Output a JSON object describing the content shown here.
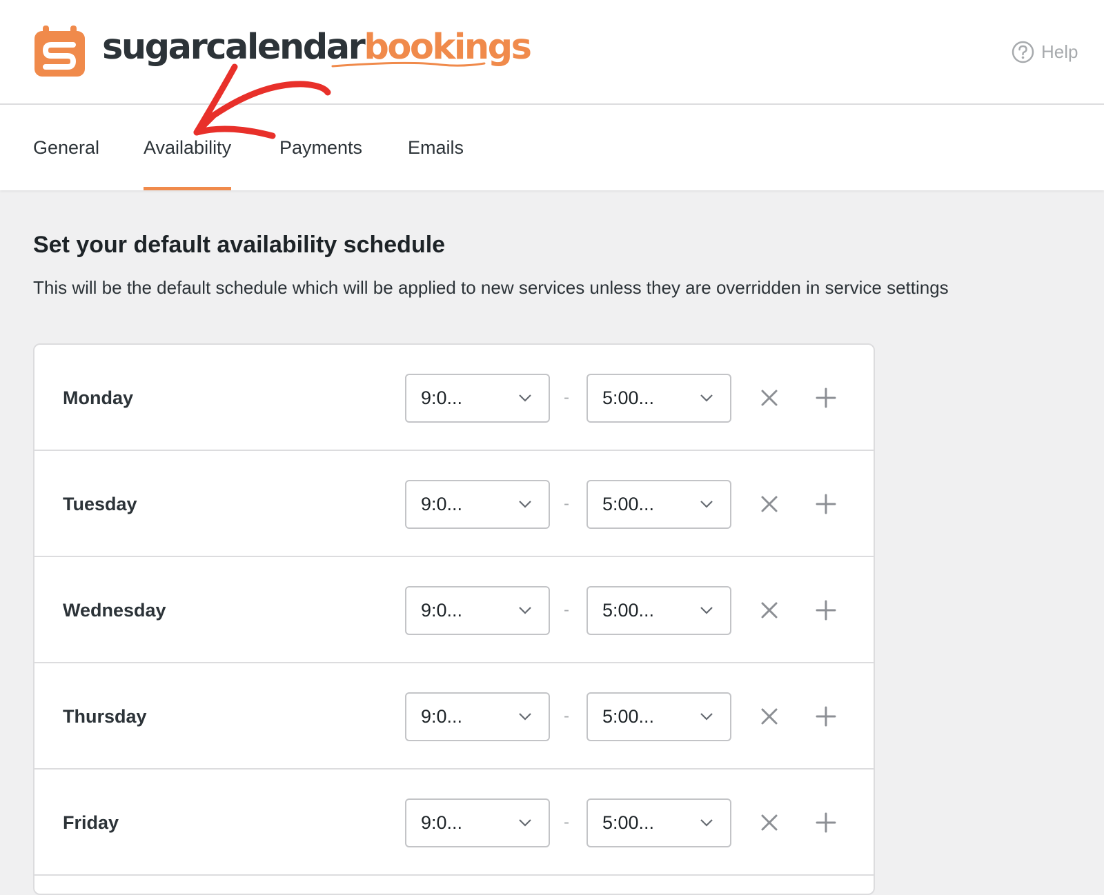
{
  "brand": {
    "name_dark": "sugarcalendar",
    "name_accent": "bookings",
    "accent_color": "#f08a4b",
    "logo_icon": "calendar-s-logo-icon"
  },
  "header": {
    "help_label": "Help",
    "help_icon": "question-circle-icon"
  },
  "tabs": [
    {
      "label": "General",
      "active": false
    },
    {
      "label": "Availability",
      "active": true
    },
    {
      "label": "Payments",
      "active": false
    },
    {
      "label": "Emails",
      "active": false
    }
  ],
  "main": {
    "title": "Set your default availability schedule",
    "description": "This will be the default schedule which will be applied to new services unless they are overridden in service settings"
  },
  "schedule": {
    "separator": "-",
    "days": [
      {
        "day": "Monday",
        "start": "9:0...",
        "end": "5:00..."
      },
      {
        "day": "Tuesday",
        "start": "9:0...",
        "end": "5:00..."
      },
      {
        "day": "Wednesday",
        "start": "9:0...",
        "end": "5:00..."
      },
      {
        "day": "Thursday",
        "start": "9:0...",
        "end": "5:00..."
      },
      {
        "day": "Friday",
        "start": "9:0...",
        "end": "5:00..."
      }
    ]
  },
  "annotation": {
    "color": "#e8302a",
    "icon": "red-arrow-annotation"
  }
}
